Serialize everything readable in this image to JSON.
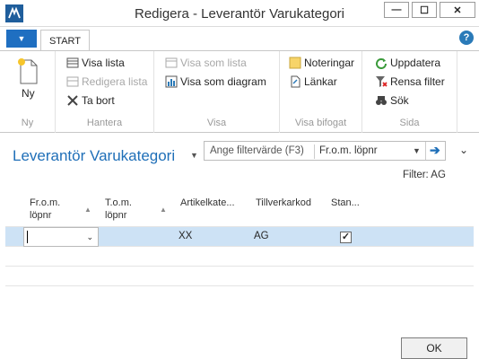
{
  "window": {
    "title": "Redigera - Leverantör Varukategori"
  },
  "ribbon": {
    "tab": "START",
    "groups": [
      {
        "label": "Ny",
        "buttons": [
          "Ny"
        ]
      },
      {
        "label": "Hantera",
        "buttons": [
          "Visa lista",
          "Redigera lista",
          "Ta bort"
        ]
      },
      {
        "label": "Visa",
        "buttons": [
          "Visa som lista",
          "Visa som diagram"
        ]
      },
      {
        "label": "Visa bifogat",
        "buttons": [
          "Noteringar",
          "Länkar"
        ]
      },
      {
        "label": "Sida",
        "buttons": [
          "Uppdatera",
          "Rensa filter",
          "Sök"
        ]
      }
    ]
  },
  "page": {
    "title": "Leverantör Varukategori",
    "filter_placeholder": "Ange filtervärde (F3)",
    "filter_field": "Fr.o.m. löpnr",
    "filter_label": "Filter: AG"
  },
  "grid": {
    "columns": [
      "Fr.o.m. löpnr",
      "T.o.m. löpnr",
      "Artikelkate...",
      "Tillverkarkod",
      "Stan..."
    ],
    "rows": [
      {
        "from": "",
        "to": "",
        "artikel": "XX",
        "tillverkar": "AG",
        "standard": true
      }
    ]
  },
  "footer": {
    "ok": "OK"
  },
  "colors": {
    "accent": "#1f6fb8",
    "selected_row": "#cde2f5",
    "frame": "#1a6fb5"
  }
}
